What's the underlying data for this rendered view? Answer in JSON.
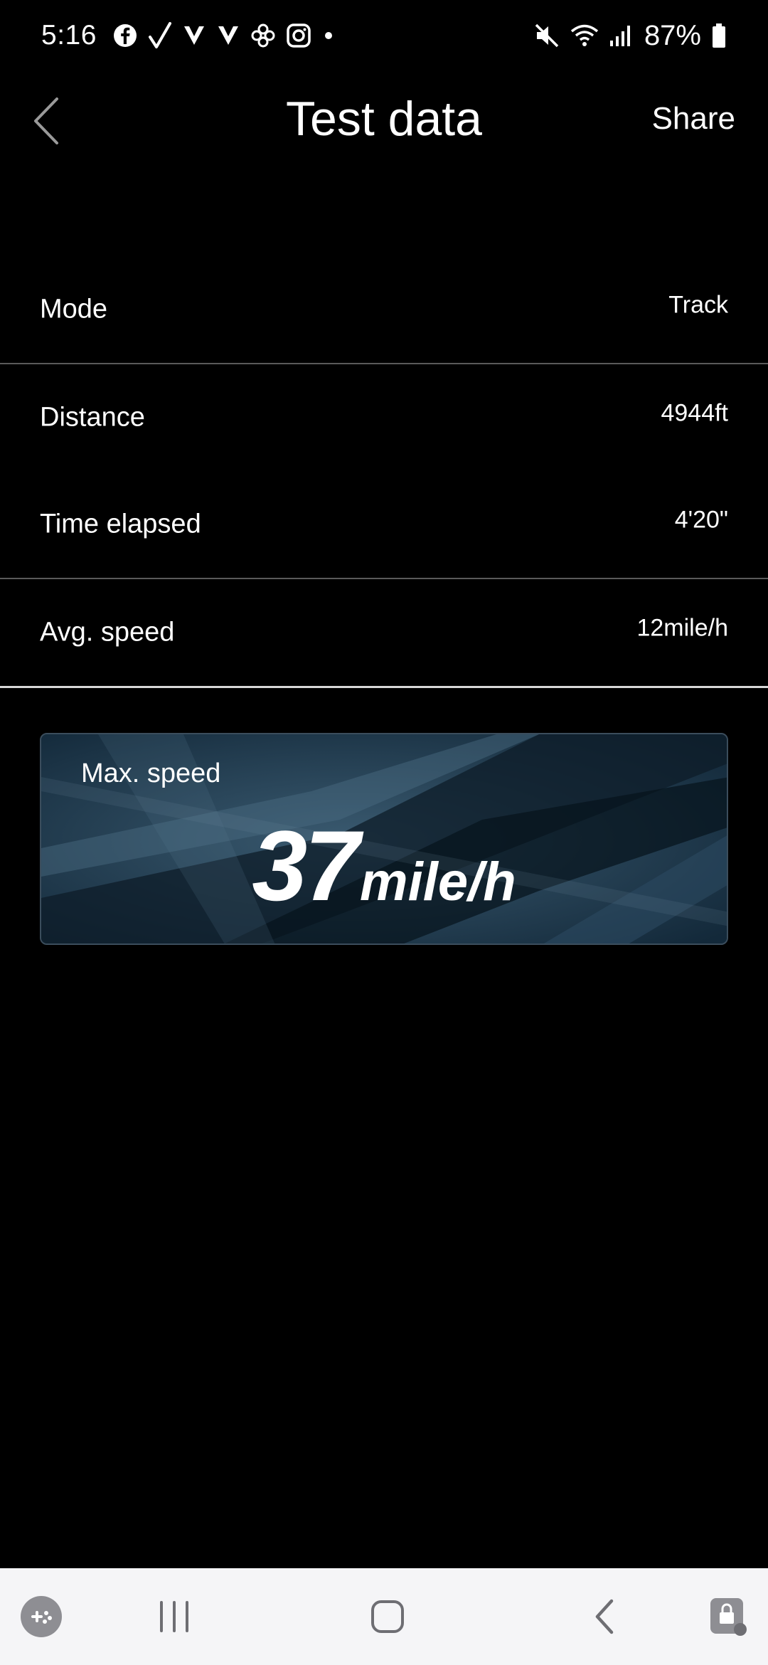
{
  "status_bar": {
    "time": "5:16",
    "battery": "87%",
    "left_icons": [
      "facebook-icon",
      "check-icon",
      "v-icon",
      "v-icon",
      "pinwheel-icon",
      "instagram-icon",
      "dot-icon"
    ],
    "right_icons": [
      "mute-icon",
      "wifi-icon",
      "signal-icon",
      "battery-icon"
    ]
  },
  "header": {
    "title": "Test data",
    "share_label": "Share",
    "back_icon": "chevron-left-icon"
  },
  "rows": [
    {
      "label": "Mode",
      "value": "Track"
    },
    {
      "label": "Distance",
      "value": "4944ft"
    },
    {
      "label": "Time elapsed",
      "value": "4'20\""
    },
    {
      "label": "Avg. speed",
      "value": "12mile/h"
    }
  ],
  "max_speed": {
    "label": "Max. speed",
    "value": "37",
    "unit": "mile/h"
  },
  "nav_bar": {
    "icons": [
      "game-launcher-icon",
      "recent-apps-icon",
      "home-icon",
      "back-icon",
      "screen-lock-icon"
    ]
  },
  "colors": {
    "background": "#000000",
    "text": "#ffffff",
    "divider": "#5a5a5a",
    "card_bg": "#183040",
    "nav_bg": "#f5f5f7"
  }
}
